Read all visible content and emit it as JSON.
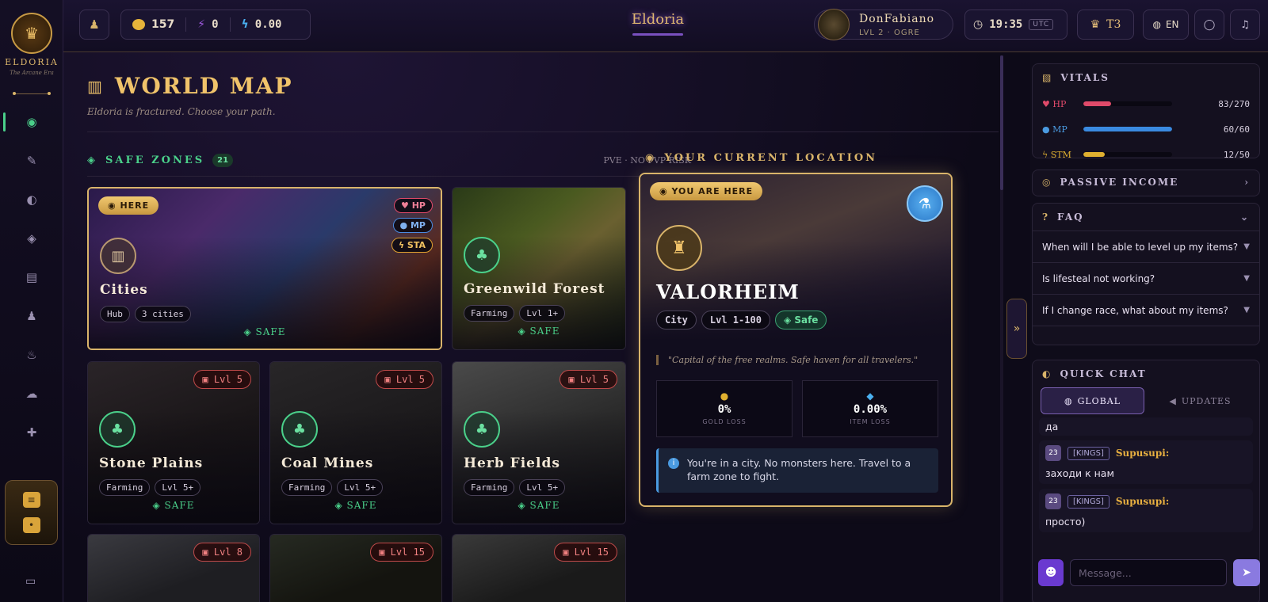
{
  "sidebar": {
    "logo_title": "ELDORIA",
    "logo_sub": "The Arcane Era",
    "items": [
      {
        "name": "profile",
        "icon": "◉"
      },
      {
        "name": "forge",
        "icon": "✎"
      },
      {
        "name": "world-map",
        "icon": "◐"
      },
      {
        "name": "defense",
        "icon": "◈"
      },
      {
        "name": "shop",
        "icon": "▤"
      },
      {
        "name": "guild",
        "icon": "♟"
      },
      {
        "name": "dungeon",
        "icon": "♨"
      },
      {
        "name": "community",
        "icon": "☁"
      },
      {
        "name": "add-friend",
        "icon": "✚"
      }
    ],
    "foot_icon": "▭"
  },
  "topbar": {
    "gold": "157",
    "shards": "0",
    "energy": "0.00",
    "brand": "Eldoria",
    "player_name": "DonFabiano",
    "player_level": "LVL 2 · OGRE",
    "time": "19:35",
    "timezone": "UTC",
    "tier": "T3",
    "language": "EN"
  },
  "main": {
    "title": "WORLD MAP",
    "subtitle": "Eldoria is fractured. Choose your path.",
    "zones_heading": "SAFE ZONES",
    "zones_count": "21",
    "zones_note": "PVE · NO PVP RISK"
  },
  "zones": [
    {
      "name": "Cities",
      "tags": [
        "Hub",
        "3 cities"
      ],
      "status": "SAFE",
      "here": "HERE",
      "stats": [
        "HP",
        "MP",
        "STA"
      ]
    },
    {
      "name": "Greenwild Forest",
      "tags": [
        "Farming",
        "Lvl 1+"
      ],
      "status": "SAFE"
    },
    {
      "name": "Stone Plains",
      "tags": [
        "Farming",
        "Lvl 5+"
      ],
      "status": "SAFE",
      "lock": "Lvl 5"
    },
    {
      "name": "Coal Mines",
      "tags": [
        "Farming",
        "Lvl 5+"
      ],
      "status": "SAFE",
      "lock": "Lvl 5"
    },
    {
      "name": "Herb Fields",
      "tags": [
        "Farming",
        "Lvl 5+"
      ],
      "status": "SAFE",
      "lock": "Lvl 5"
    },
    {
      "lock": "Lvl 8"
    },
    {
      "lock": "Lvl 15"
    },
    {
      "lock": "Lvl 15"
    }
  ],
  "location": {
    "heading": "YOUR CURRENT LOCATION",
    "badge": "YOU ARE HERE",
    "name": "VALORHEIM",
    "tags": [
      "City",
      "Lvl 1-100",
      "Safe"
    ],
    "quote": "\"Capital of the free realms. Safe haven for all travelers.\"",
    "gold_loss": "0%",
    "gold_loss_label": "GOLD LOSS",
    "item_loss": "0.00%",
    "item_loss_label": "ITEM LOSS",
    "info": "You're in a city. No monsters here. Travel to a farm zone to fight."
  },
  "right": {
    "vitals_title": "VITALS",
    "vitals": [
      {
        "name": "HP",
        "value": "83/270",
        "fraction": 0.31,
        "color": "#e04a6a"
      },
      {
        "name": "MP",
        "value": "60/60",
        "fraction": 1.0,
        "color": "#3a8ae0"
      },
      {
        "name": "STM",
        "value": "12/50",
        "fraction": 0.24,
        "color": "#e0b030"
      }
    ],
    "passive_title": "PASSIVE INCOME",
    "faq_title": "FAQ",
    "faq": [
      "When will I be able to level up my items?",
      "Is lifesteal not working?",
      "If I change race, what about my items?"
    ],
    "chat_title": "QUICK CHAT",
    "chat_tabs": [
      "GLOBAL",
      "UPDATES"
    ],
    "partial_message": "да",
    "messages": [
      {
        "level": "23",
        "guild": "[KINGS]",
        "user": "Supusupi:",
        "text": "заходи к нам"
      },
      {
        "level": "23",
        "guild": "[KINGS]",
        "user": "Supusupi:",
        "text": "просто)"
      }
    ],
    "input_placeholder": "Message..."
  }
}
